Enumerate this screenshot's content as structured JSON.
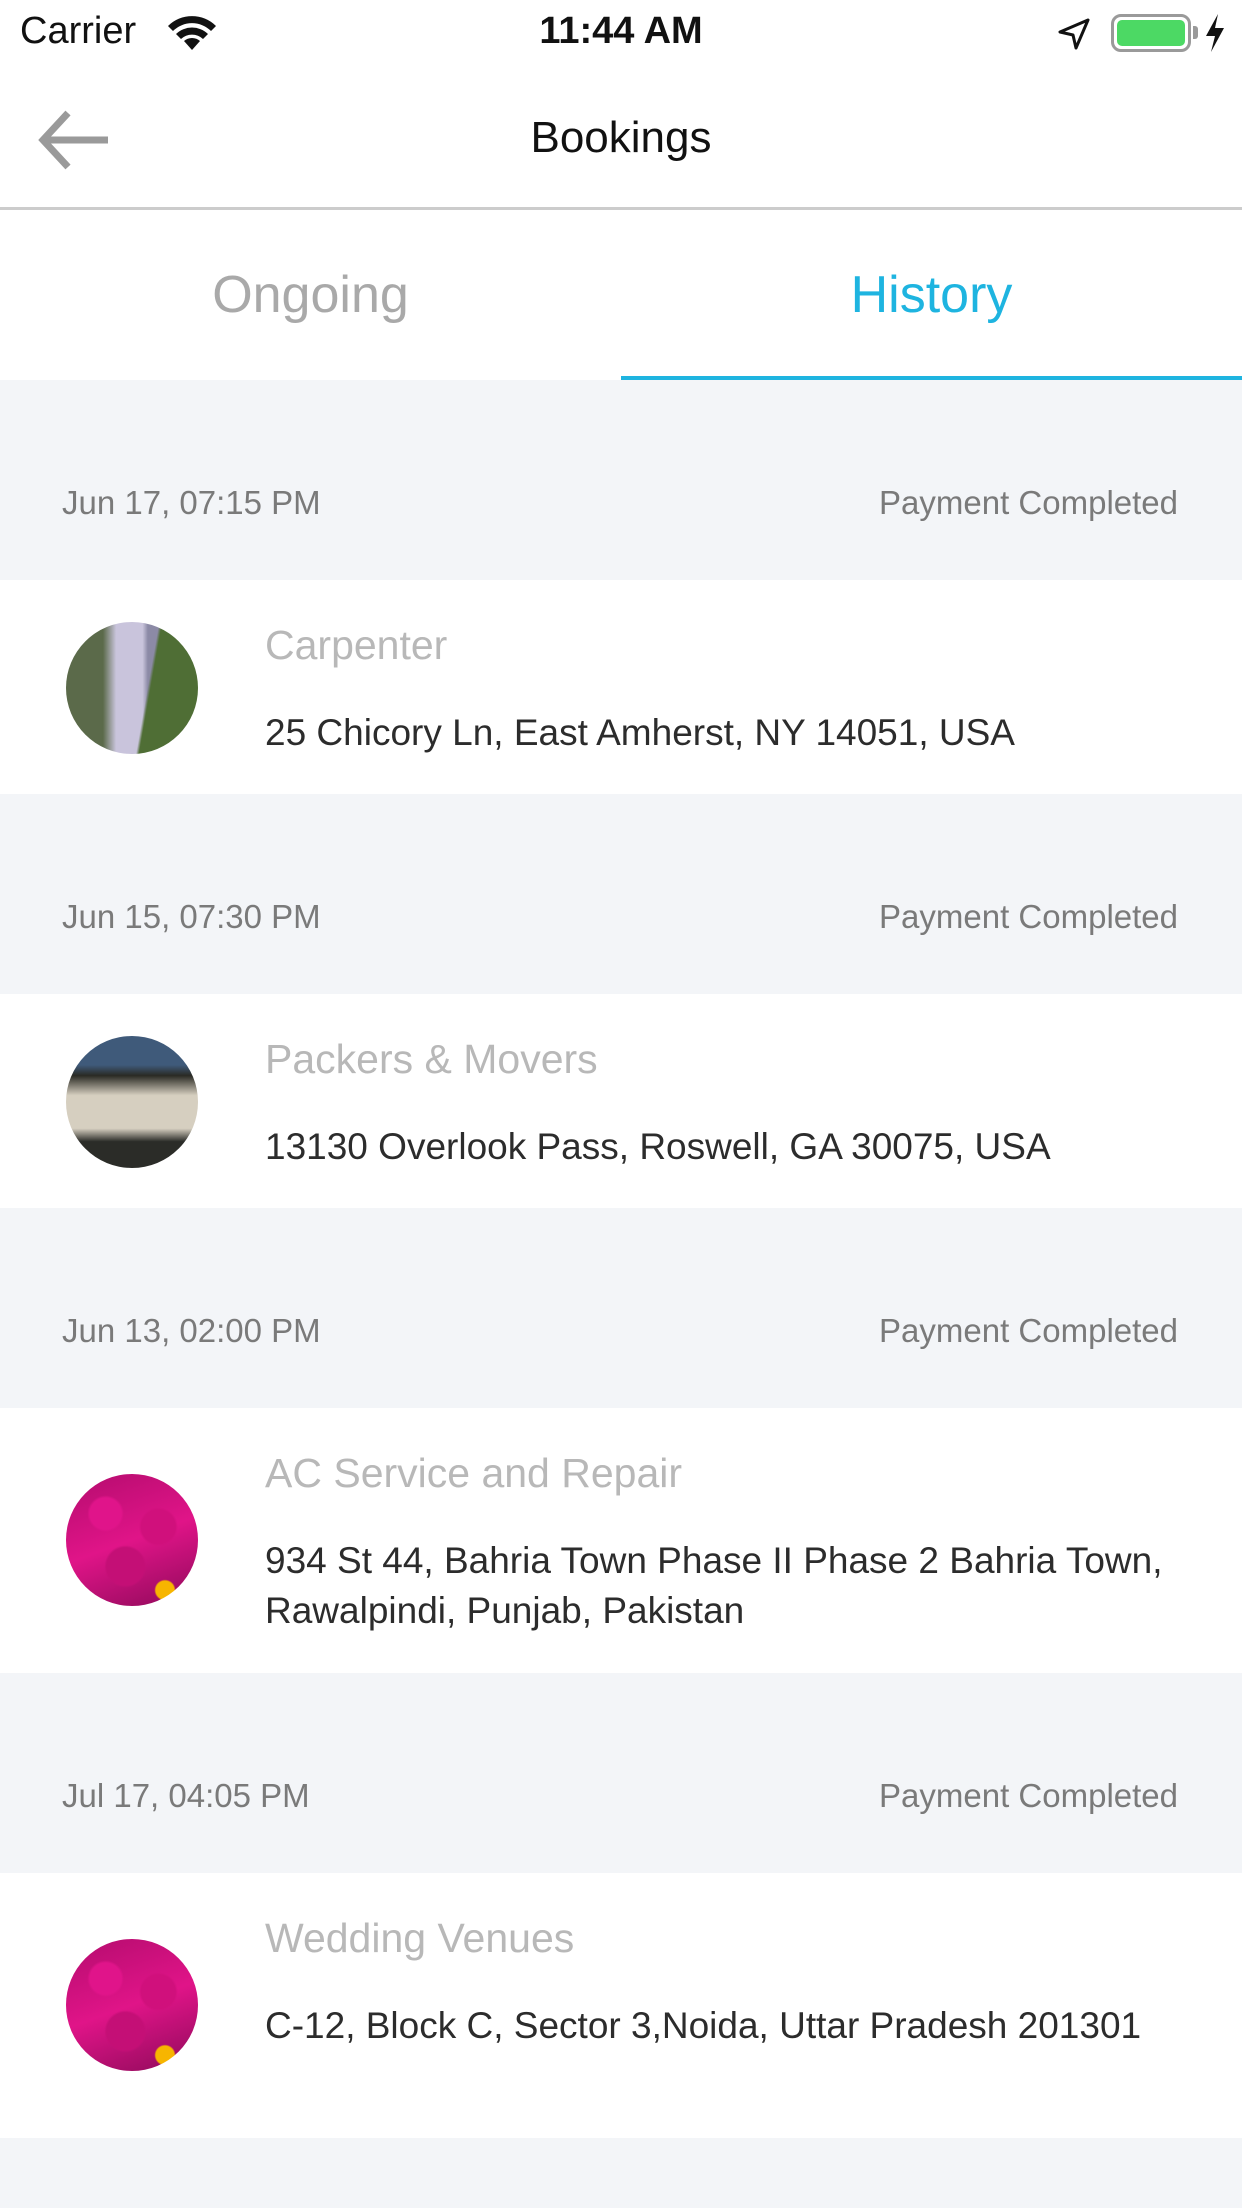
{
  "status_bar": {
    "carrier": "Carrier",
    "time": "11:44 AM",
    "wifi_icon": "wifi-icon",
    "location_icon": "location-arrow-icon",
    "battery_icon": "battery-full-icon",
    "charging_icon": "charging-bolt-icon",
    "battery_color": "#4cd964"
  },
  "nav": {
    "title": "Bookings",
    "back_icon": "arrow-left-icon"
  },
  "tabs": [
    {
      "label": "Ongoing",
      "active": false
    },
    {
      "label": "History",
      "active": true
    }
  ],
  "accent_color": "#1eb4e0",
  "bookings": [
    {
      "date": "Jun 17, 07:15 PM",
      "status": "Payment Completed",
      "service": "Carpenter",
      "address": "25 Chicory Ln, East Amherst, NY 14051, USA",
      "image": "waterfall-photo"
    },
    {
      "date": "Jun 15, 07:30 PM",
      "status": "Payment Completed",
      "service": "Packers & Movers",
      "address": "13130 Overlook Pass, Roswell, GA 30075, USA",
      "image": "interior-photo"
    },
    {
      "date": "Jun 13, 02:00 PM",
      "status": "Payment Completed",
      "service": "AC Service and Repair",
      "address": "934 St 44, Bahria Town Phase II Phase 2 Bahria Town, Rawalpindi, Punjab, Pakistan",
      "image": "flowers-photo"
    },
    {
      "date": "Jul 17, 04:05 PM",
      "status": "Payment Completed",
      "service": "Wedding Venues",
      "address": "C-12, Block C, Sector 3,Noida, Uttar Pradesh 201301",
      "image": "flowers-photo"
    }
  ]
}
